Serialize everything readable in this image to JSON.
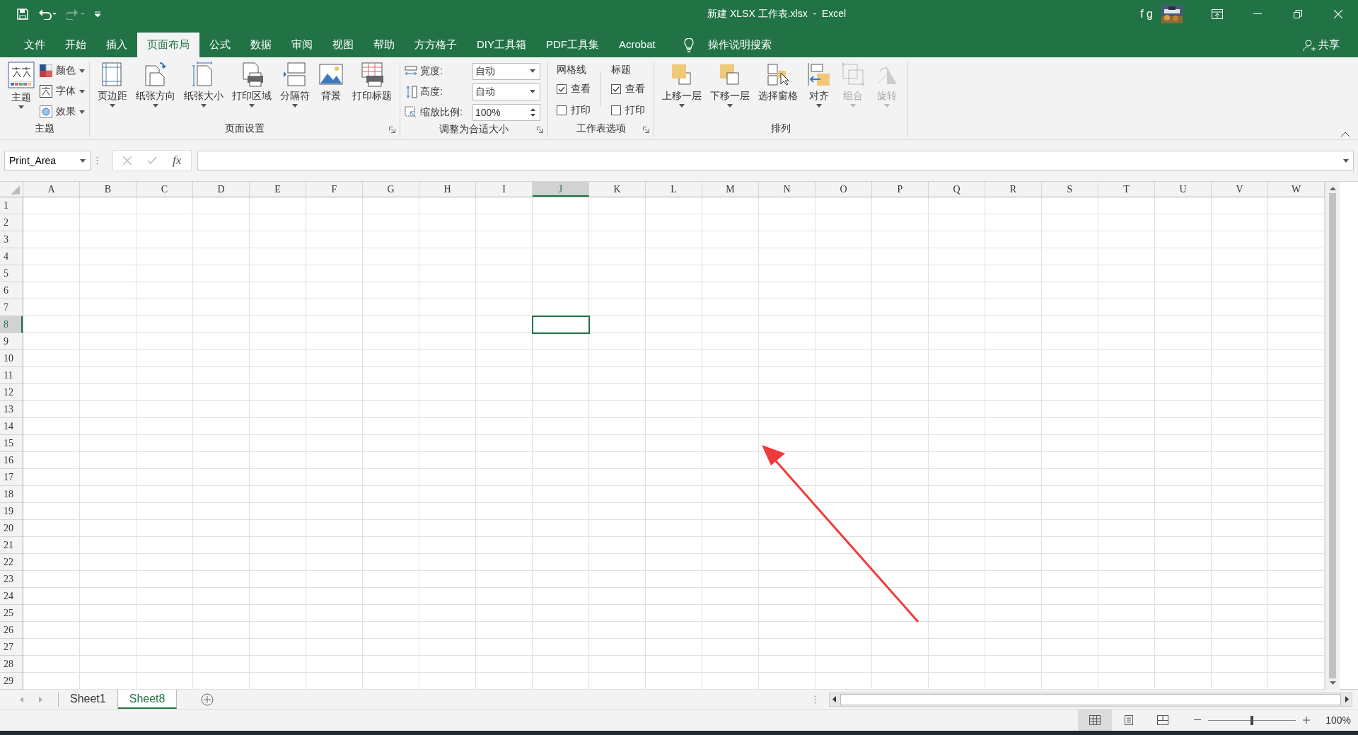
{
  "title_bar": {
    "title": "新建 XLSX 工作表.xlsx  -  Excel",
    "user": "f g",
    "redo_disabled": true
  },
  "menu_tabs": [
    {
      "label": "文件",
      "selected": false
    },
    {
      "label": "开始",
      "selected": false
    },
    {
      "label": "插入",
      "selected": false
    },
    {
      "label": "页面布局",
      "selected": true
    },
    {
      "label": "公式",
      "selected": false
    },
    {
      "label": "数据",
      "selected": false
    },
    {
      "label": "审阅",
      "selected": false
    },
    {
      "label": "视图",
      "selected": false
    },
    {
      "label": "帮助",
      "selected": false
    },
    {
      "label": "方方格子",
      "selected": false
    },
    {
      "label": "DIY工具箱",
      "selected": false
    },
    {
      "label": "PDF工具集",
      "selected": false
    },
    {
      "label": "Acrobat",
      "selected": false
    }
  ],
  "tell_me": "操作说明搜索",
  "share": "共享",
  "ribbon": {
    "groups": [
      {
        "kind": "theme",
        "label": "主题",
        "launcher": false,
        "main": {
          "label": "主题",
          "dropdown": true
        },
        "items": [
          {
            "label": "颜色"
          },
          {
            "label": "字体"
          },
          {
            "label": "效果"
          }
        ]
      },
      {
        "kind": "buttons",
        "label": "页面设置",
        "launcher": true,
        "items": [
          {
            "label": "页边距",
            "dropdown": true,
            "disabled": false
          },
          {
            "label": "纸张方向",
            "dropdown": true,
            "disabled": false
          },
          {
            "label": "纸张大小",
            "dropdown": true,
            "disabled": false
          },
          {
            "label": "打印区域",
            "dropdown": true,
            "disabled": false
          },
          {
            "label": "分隔符",
            "dropdown": true,
            "disabled": false
          },
          {
            "label": "背景",
            "dropdown": false,
            "disabled": false
          },
          {
            "label": "打印标题",
            "dropdown": false,
            "disabled": false
          }
        ]
      },
      {
        "kind": "fit",
        "label": "调整为合适大小",
        "launcher": true,
        "items": [
          {
            "label": "宽度:",
            "value": "自动",
            "kind": "dropdown"
          },
          {
            "label": "高度:",
            "value": "自动",
            "kind": "dropdown"
          },
          {
            "label": "缩放比例:",
            "value": "100%",
            "kind": "spinner"
          }
        ]
      },
      {
        "kind": "options",
        "label": "工作表选项",
        "launcher": true,
        "items": [
          {
            "label": "网格线",
            "options": [
              {
                "label": "查看",
                "checked": true
              },
              {
                "label": "打印",
                "checked": false
              }
            ]
          },
          {
            "label": "标题",
            "options": [
              {
                "label": "查看",
                "checked": true
              },
              {
                "label": "打印",
                "checked": false
              }
            ]
          }
        ]
      },
      {
        "kind": "buttons",
        "label": "排列",
        "launcher": false,
        "items": [
          {
            "label": "上移一层",
            "dropdown": true,
            "disabled": false
          },
          {
            "label": "下移一层",
            "dropdown": true,
            "disabled": false
          },
          {
            "label": "选择窗格",
            "dropdown": false,
            "disabled": false
          },
          {
            "label": "对齐",
            "dropdown": true,
            "disabled": false
          },
          {
            "label": "组合",
            "dropdown": true,
            "disabled": true
          },
          {
            "label": "旋转",
            "dropdown": true,
            "disabled": true
          }
        ]
      }
    ]
  },
  "formula_bar": {
    "name_box": "Print_Area",
    "fx": "fx"
  },
  "sheet": {
    "columns": [
      {
        "label": "A",
        "selected": false
      },
      {
        "label": "B",
        "selected": false
      },
      {
        "label": "C",
        "selected": false
      },
      {
        "label": "D",
        "selected": false
      },
      {
        "label": "E",
        "selected": false
      },
      {
        "label": "F",
        "selected": false
      },
      {
        "label": "G",
        "selected": false
      },
      {
        "label": "H",
        "selected": false
      },
      {
        "label": "I",
        "selected": false
      },
      {
        "label": "J",
        "selected": true
      },
      {
        "label": "K",
        "selected": false
      },
      {
        "label": "L",
        "selected": false
      },
      {
        "label": "M",
        "selected": false
      },
      {
        "label": "N",
        "selected": false
      },
      {
        "label": "O",
        "selected": false
      },
      {
        "label": "P",
        "selected": false
      },
      {
        "label": "Q",
        "selected": false
      },
      {
        "label": "R",
        "selected": false
      },
      {
        "label": "S",
        "selected": false
      },
      {
        "label": "T",
        "selected": false
      },
      {
        "label": "U",
        "selected": false
      },
      {
        "label": "V",
        "selected": false
      },
      {
        "label": "W",
        "selected": false
      }
    ],
    "rows": [
      {
        "label": "1",
        "selected": false
      },
      {
        "label": "2",
        "selected": false
      },
      {
        "label": "3",
        "selected": false
      },
      {
        "label": "4",
        "selected": false
      },
      {
        "label": "5",
        "selected": false
      },
      {
        "label": "6",
        "selected": false
      },
      {
        "label": "7",
        "selected": false
      },
      {
        "label": "8",
        "selected": true
      },
      {
        "label": "9",
        "selected": false
      },
      {
        "label": "10",
        "selected": false
      },
      {
        "label": "11",
        "selected": false
      },
      {
        "label": "12",
        "selected": false
      },
      {
        "label": "13",
        "selected": false
      },
      {
        "label": "14",
        "selected": false
      },
      {
        "label": "15",
        "selected": false
      },
      {
        "label": "16",
        "selected": false
      },
      {
        "label": "17",
        "selected": false
      },
      {
        "label": "18",
        "selected": false
      },
      {
        "label": "19",
        "selected": false
      },
      {
        "label": "20",
        "selected": false
      },
      {
        "label": "21",
        "selected": false
      },
      {
        "label": "22",
        "selected": false
      },
      {
        "label": "23",
        "selected": false
      },
      {
        "label": "24",
        "selected": false
      },
      {
        "label": "25",
        "selected": false
      },
      {
        "label": "26",
        "selected": false
      },
      {
        "label": "27",
        "selected": false
      },
      {
        "label": "28",
        "selected": false
      },
      {
        "label": "29",
        "selected": false
      }
    ]
  },
  "sheet_tabs": [
    {
      "label": "Sheet1",
      "selected": false
    },
    {
      "label": "Sheet8",
      "selected": true
    }
  ],
  "status_bar": {
    "views": [
      {
        "selected": true
      },
      {
        "selected": false
      },
      {
        "selected": false
      }
    ],
    "zoom": {
      "level": 0.5,
      "reading": "100%"
    }
  },
  "annotation": {
    "kind": "arrow",
    "color": "#f03a3a"
  }
}
